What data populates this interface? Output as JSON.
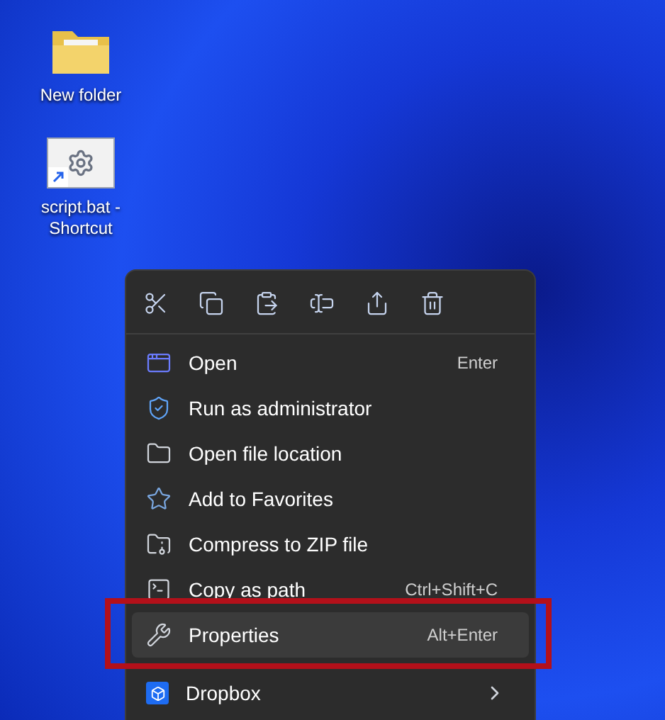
{
  "desktop_icons": [
    {
      "label": "New folder",
      "kind": "folder"
    },
    {
      "label": "script.bat - Shortcut",
      "kind": "shortcut"
    }
  ],
  "context_menu": {
    "items": [
      {
        "label": "Open",
        "shortcut": "Enter",
        "kind": "command",
        "selected": false,
        "annotated": false
      },
      {
        "label": "Run as administrator",
        "kind": "command",
        "selected": false,
        "annotated": false
      },
      {
        "label": "Open file location",
        "kind": "command",
        "selected": false,
        "annotated": false
      },
      {
        "label": "Add to Favorites",
        "kind": "command",
        "selected": false,
        "annotated": false
      },
      {
        "label": "Compress to ZIP file",
        "kind": "command",
        "selected": false,
        "annotated": false
      },
      {
        "label": "Copy as path",
        "shortcut": "Ctrl+Shift+C",
        "kind": "command",
        "selected": false,
        "annotated": false
      },
      {
        "label": "Properties",
        "shortcut": "Alt+Enter",
        "kind": "command",
        "selected": true,
        "annotated": true
      },
      {
        "label": "Dropbox",
        "kind": "submenu",
        "selected": false,
        "annotated": false
      }
    ]
  }
}
